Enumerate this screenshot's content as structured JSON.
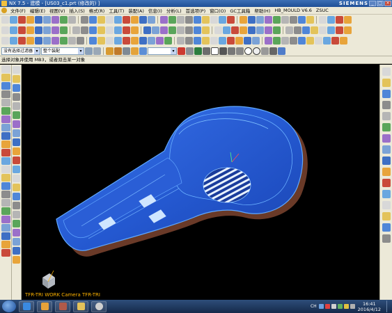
{
  "window": {
    "title": "NX 7.5 - 建模 - [US03_c1.prt (修改的) ]",
    "brand": "SIEMENS",
    "controls": [
      "_",
      "□",
      "×"
    ]
  },
  "menubar": {
    "items": [
      "文件(F)",
      "编辑(E)",
      "视图(V)",
      "插入(S)",
      "格式(R)",
      "工具(T)",
      "装配(A)",
      "信息(I)",
      "分析(L)",
      "首选项(P)",
      "窗口(O)",
      "GC工具箱",
      "帮助(H)",
      "HB_MOULD V6.6",
      "ZSUC"
    ]
  },
  "selection_bar": {
    "filter_value": "没有选择过滤器",
    "scope_value": "整个装配"
  },
  "cue_line": {
    "text": "选择对象并使用 MB3，或者双击某一对象"
  },
  "graphics": {
    "view_name": "TFR-TRI WORK Camera TFR-TRI"
  },
  "taskbar": {
    "tray_ime": "CH",
    "time": "16:41",
    "date": "2016/4/12"
  },
  "colors": {
    "part_surface": "#2a5fd8",
    "part_edge": "#4f9aff",
    "part_underside": "#6a3a28",
    "pad_faces": "#cfe6ff",
    "vent_stripes": "#e8f2ff",
    "background": "#000000",
    "view_label": "#ffb400"
  },
  "icons": {
    "app": "nx-app-icon",
    "start": "windows-start-icon",
    "tasks": [
      "ie-icon",
      "nx-task-icon",
      "photo-icon",
      "folder-icon",
      "media-icon"
    ]
  }
}
